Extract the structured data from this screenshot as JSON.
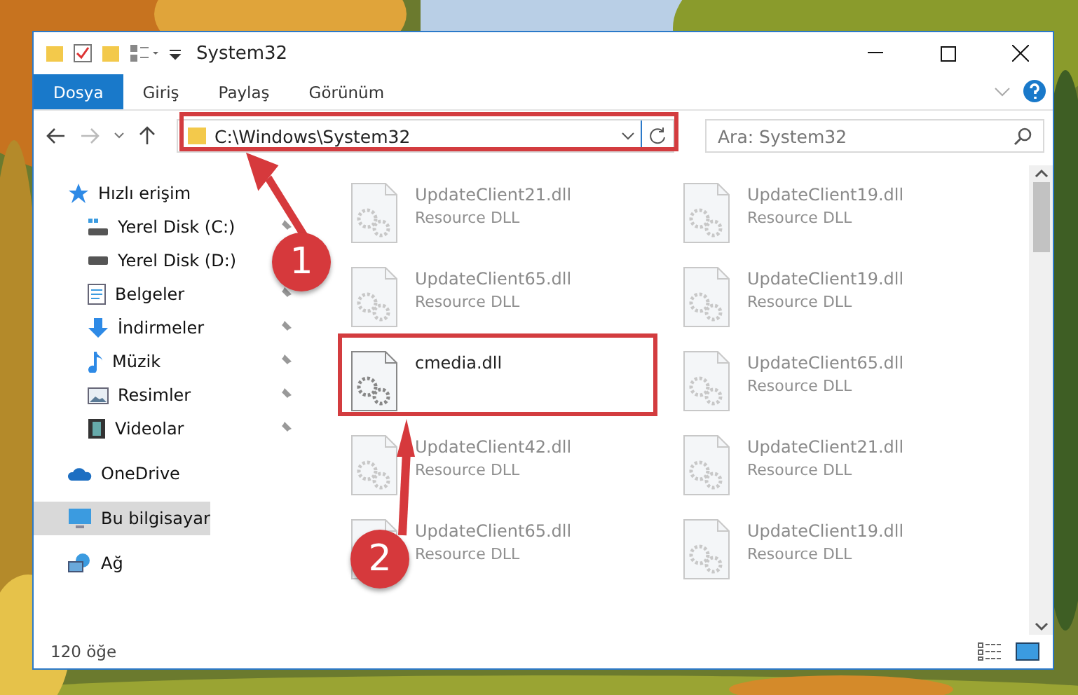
{
  "window": {
    "title": "System32"
  },
  "ribbon_tabs": [
    {
      "label": "Dosya",
      "selected": true
    },
    {
      "label": "Giriş",
      "selected": false
    },
    {
      "label": "Paylaş",
      "selected": false
    },
    {
      "label": "Görünüm",
      "selected": false
    }
  ],
  "address": {
    "path": "C:\\Windows\\System32"
  },
  "search": {
    "placeholder": "Ara: System32"
  },
  "sidebar": {
    "items": [
      {
        "label": "Hızlı erişim",
        "kind": "star",
        "selected": false,
        "children": [
          {
            "label": "Yerel Disk (C:)",
            "kind": "system-drive",
            "pinned": true,
            "selected": false
          },
          {
            "label": "Yerel Disk (D:)",
            "kind": "drive",
            "pinned": false,
            "selected": false
          },
          {
            "label": "Belgeler",
            "kind": "documents",
            "pinned": true,
            "selected": false
          },
          {
            "label": "İndirmeler",
            "kind": "downloads",
            "pinned": true,
            "selected": false
          },
          {
            "label": "Müzik",
            "kind": "music",
            "pinned": true,
            "selected": false
          },
          {
            "label": "Resimler",
            "kind": "pictures",
            "pinned": true,
            "selected": false
          },
          {
            "label": "Videolar",
            "kind": "videos",
            "pinned": true,
            "selected": false
          }
        ]
      },
      {
        "label": "OneDrive",
        "kind": "cloud",
        "selected": false
      },
      {
        "label": "Bu bilgisayar",
        "kind": "computer",
        "selected": true
      },
      {
        "label": "Ağ",
        "kind": "network",
        "selected": false
      }
    ]
  },
  "files": [
    {
      "name": "UpdateClient21.dll",
      "type": "Resource DLL",
      "dimmed": true
    },
    {
      "name": "UpdateClient19.dll",
      "type": "Resource DLL",
      "dimmed": true
    },
    {
      "name": "UpdateClient65.dll",
      "type": "Resource DLL",
      "dimmed": true
    },
    {
      "name": "UpdateClient19.dll",
      "type": "Resource DLL",
      "dimmed": true
    },
    {
      "name": "cmedia.dll",
      "dimmed": false
    },
    {
      "name": "UpdateClient65.dll",
      "type": "Resource DLL",
      "dimmed": true
    },
    {
      "name": "UpdateClient42.dll",
      "type": "Resource DLL",
      "dimmed": true
    },
    {
      "name": "UpdateClient21.dll",
      "type": "Resource DLL",
      "dimmed": true
    },
    {
      "name": "UpdateClient65.dll",
      "type": "Resource DLL",
      "dimmed": true
    },
    {
      "name": "UpdateClient19.dll",
      "type": "Resource DLL",
      "dimmed": true
    }
  ],
  "status_bar": {
    "count": "120 öğe"
  },
  "callouts": [
    {
      "number": "1"
    },
    {
      "number": "2"
    }
  ]
}
